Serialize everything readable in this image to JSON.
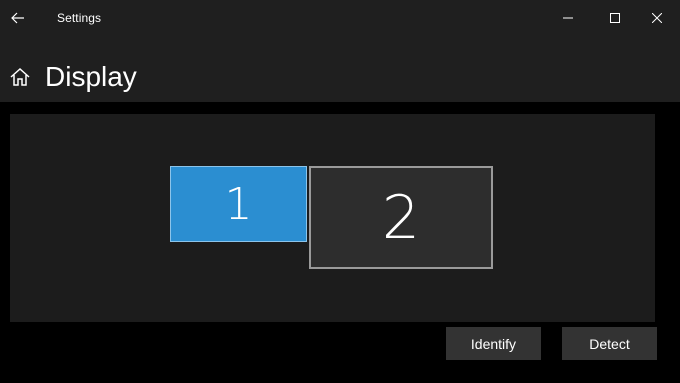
{
  "window": {
    "title": "Settings",
    "back_icon": "back-arrow-icon",
    "controls": [
      "minimize-icon",
      "maximize-icon",
      "close-icon"
    ]
  },
  "header": {
    "home_icon": "home-icon",
    "title": "Display"
  },
  "arrangement": {
    "monitors": [
      {
        "number": "1",
        "selected": true,
        "color": "#2b8ed1"
      },
      {
        "number": "2",
        "selected": false,
        "color": "#2d2d2d"
      }
    ]
  },
  "actions": {
    "identify_label": "Identify",
    "detect_label": "Detect"
  },
  "colors": {
    "accent": "#2b8ed1",
    "titlebar": "#1f1f1f",
    "button": "#333333"
  }
}
